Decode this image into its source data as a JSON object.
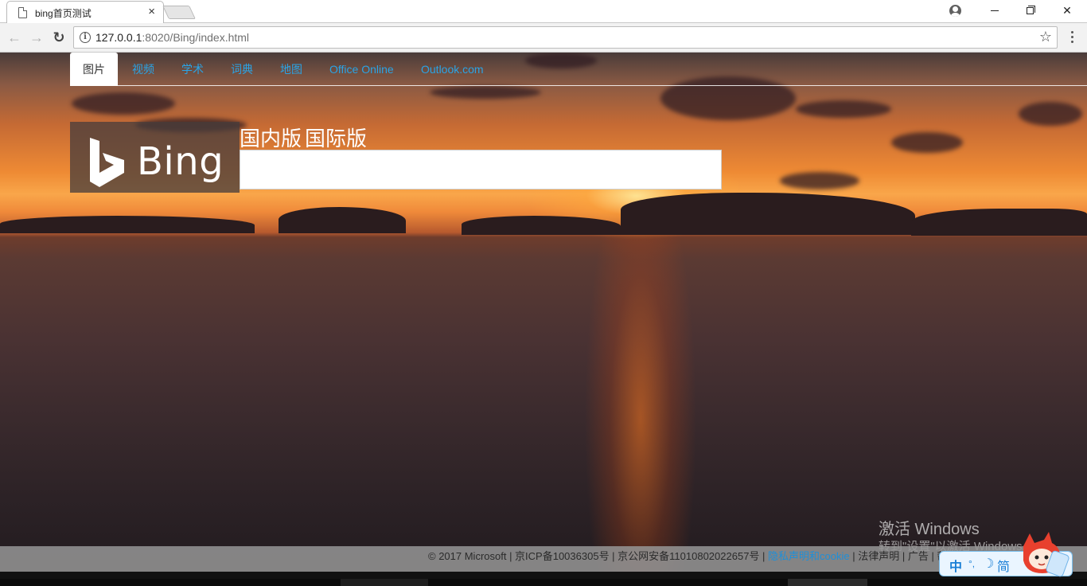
{
  "browser": {
    "tab_title": "bing首页测试",
    "tab_close": "×",
    "url_host": "127.0.0.1",
    "url_rest": ":8020/Bing/index.html",
    "info_symbol": "i",
    "star_symbol": "☆",
    "back_symbol": "←",
    "forward_symbol": "→",
    "reload_symbol": "↻",
    "close_symbol": "✕"
  },
  "nav": {
    "tabs": [
      "图片",
      "视频",
      "学术",
      "词典",
      "地图",
      "Office Online",
      "Outlook.com"
    ],
    "active_index": 0,
    "link_color": "#2aa4e6"
  },
  "logo": {
    "text": "Bing"
  },
  "editions": {
    "domestic": "国内版",
    "international": "国际版"
  },
  "search": {
    "value": "",
    "placeholder": ""
  },
  "footer": {
    "copyright": "© 2017 Microsoft | 京ICP备10036305号 | 京公网安备11010802022657号 | ",
    "privacy_link": "隐私声明和cookie",
    "legal": " | 法律声明 | 广告 | 帮助 | 反馈"
  },
  "watermark": {
    "line1": "激活 Windows",
    "line2": "转到\"设置\"以激活 Windows。"
  },
  "ime": {
    "mode": "中",
    "punct": "°,",
    "moon": "☽",
    "variant": "简"
  }
}
